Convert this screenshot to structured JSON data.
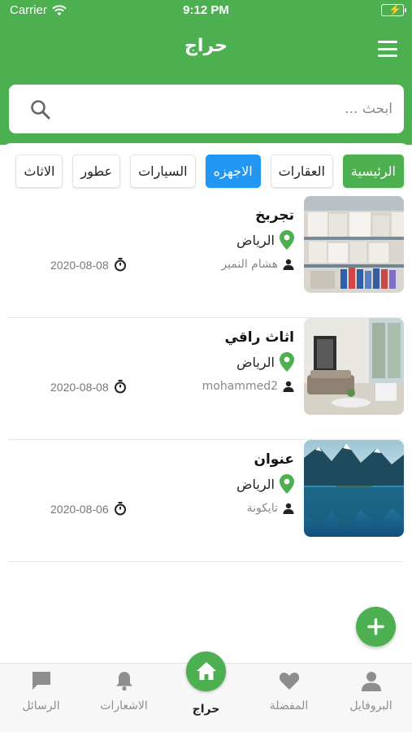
{
  "status": {
    "carrier": "Carrier",
    "time": "9:12 PM"
  },
  "header": {
    "title": "حراج"
  },
  "search": {
    "placeholder": "ابحث ..."
  },
  "categories": [
    {
      "label": "الرئيسية",
      "state": "home"
    },
    {
      "label": "العقارات",
      "state": "normal"
    },
    {
      "label": "الاجهزه",
      "state": "selected"
    },
    {
      "label": "السيارات",
      "state": "normal"
    },
    {
      "label": "عطور",
      "state": "normal"
    },
    {
      "label": "الاثاث",
      "state": "normal"
    }
  ],
  "listings": [
    {
      "title": "تجربخ",
      "location": "الرياض",
      "user": "هشام النمير",
      "date": "2020-08-08",
      "image": "shelves-photo"
    },
    {
      "title": "اثاث راقي",
      "location": "الرياض",
      "user": "mohammed2",
      "date": "2020-08-08",
      "image": "living-room-photo"
    },
    {
      "title": "عنوان",
      "location": "الرياض",
      "user": "تايكونة",
      "date": "2020-08-06",
      "image": "mountain-lake-photo"
    }
  ],
  "tabs": {
    "profile": "البروفايل",
    "favorites": "المفضلة",
    "home": "حراج",
    "notifications": "الاشعارات",
    "messages": "الرسائل"
  },
  "colors": {
    "primary": "#4caf50",
    "selected_chip": "#2196f3"
  },
  "icons": [
    "wifi-icon",
    "battery-icon",
    "menu-icon",
    "search-icon",
    "location-pin-icon",
    "user-icon",
    "timer-icon",
    "plus-icon",
    "profile-icon",
    "heart-icon",
    "home-icon",
    "bell-icon",
    "chat-icon"
  ]
}
